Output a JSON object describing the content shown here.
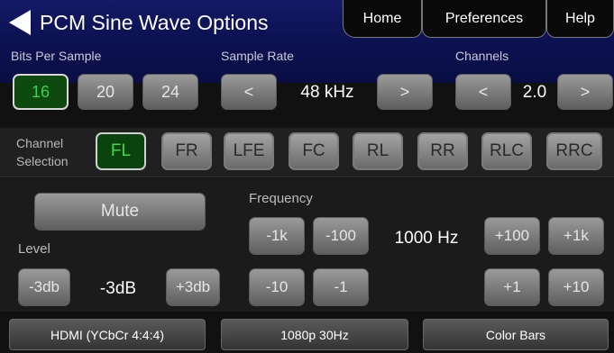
{
  "header": {
    "title": "PCM Sine Wave Options",
    "nav": {
      "home": "Home",
      "preferences": "Preferences",
      "help": "Help"
    }
  },
  "bits_per_sample": {
    "label": "Bits Per Sample",
    "options": [
      "16",
      "20",
      "24"
    ],
    "selected": "16"
  },
  "sample_rate": {
    "label": "Sample Rate",
    "prev": "<",
    "value": "48 kHz",
    "next": ">"
  },
  "channels": {
    "label": "Channels",
    "prev": "<",
    "value": "2.0",
    "next": ">"
  },
  "channel_selection": {
    "label": "Channel Selection",
    "channels": [
      "FL",
      "FR",
      "LFE",
      "FC",
      "RL",
      "RR",
      "RLC",
      "RRC"
    ],
    "selected": "FL"
  },
  "level": {
    "mute": "Mute",
    "label": "Level",
    "minus": "-3db",
    "value": "-3dB",
    "plus": "+3db"
  },
  "frequency": {
    "label": "Frequency",
    "minus_1k": "-1k",
    "minus_100": "-100",
    "minus_10": "-10",
    "minus_1": "-1",
    "value": "1000 Hz",
    "plus_100": "+100",
    "plus_1k": "+1k",
    "plus_1": "+1",
    "plus_10": "+10"
  },
  "footer": {
    "video_format": "HDMI (YCbCr 4:4:4)",
    "resolution": "1080p 30Hz",
    "pattern": "Color Bars"
  },
  "colors": {
    "header_bg": "#0c1152",
    "selected_text": "#3cd24a",
    "selected_bg": "#0e4a10"
  }
}
